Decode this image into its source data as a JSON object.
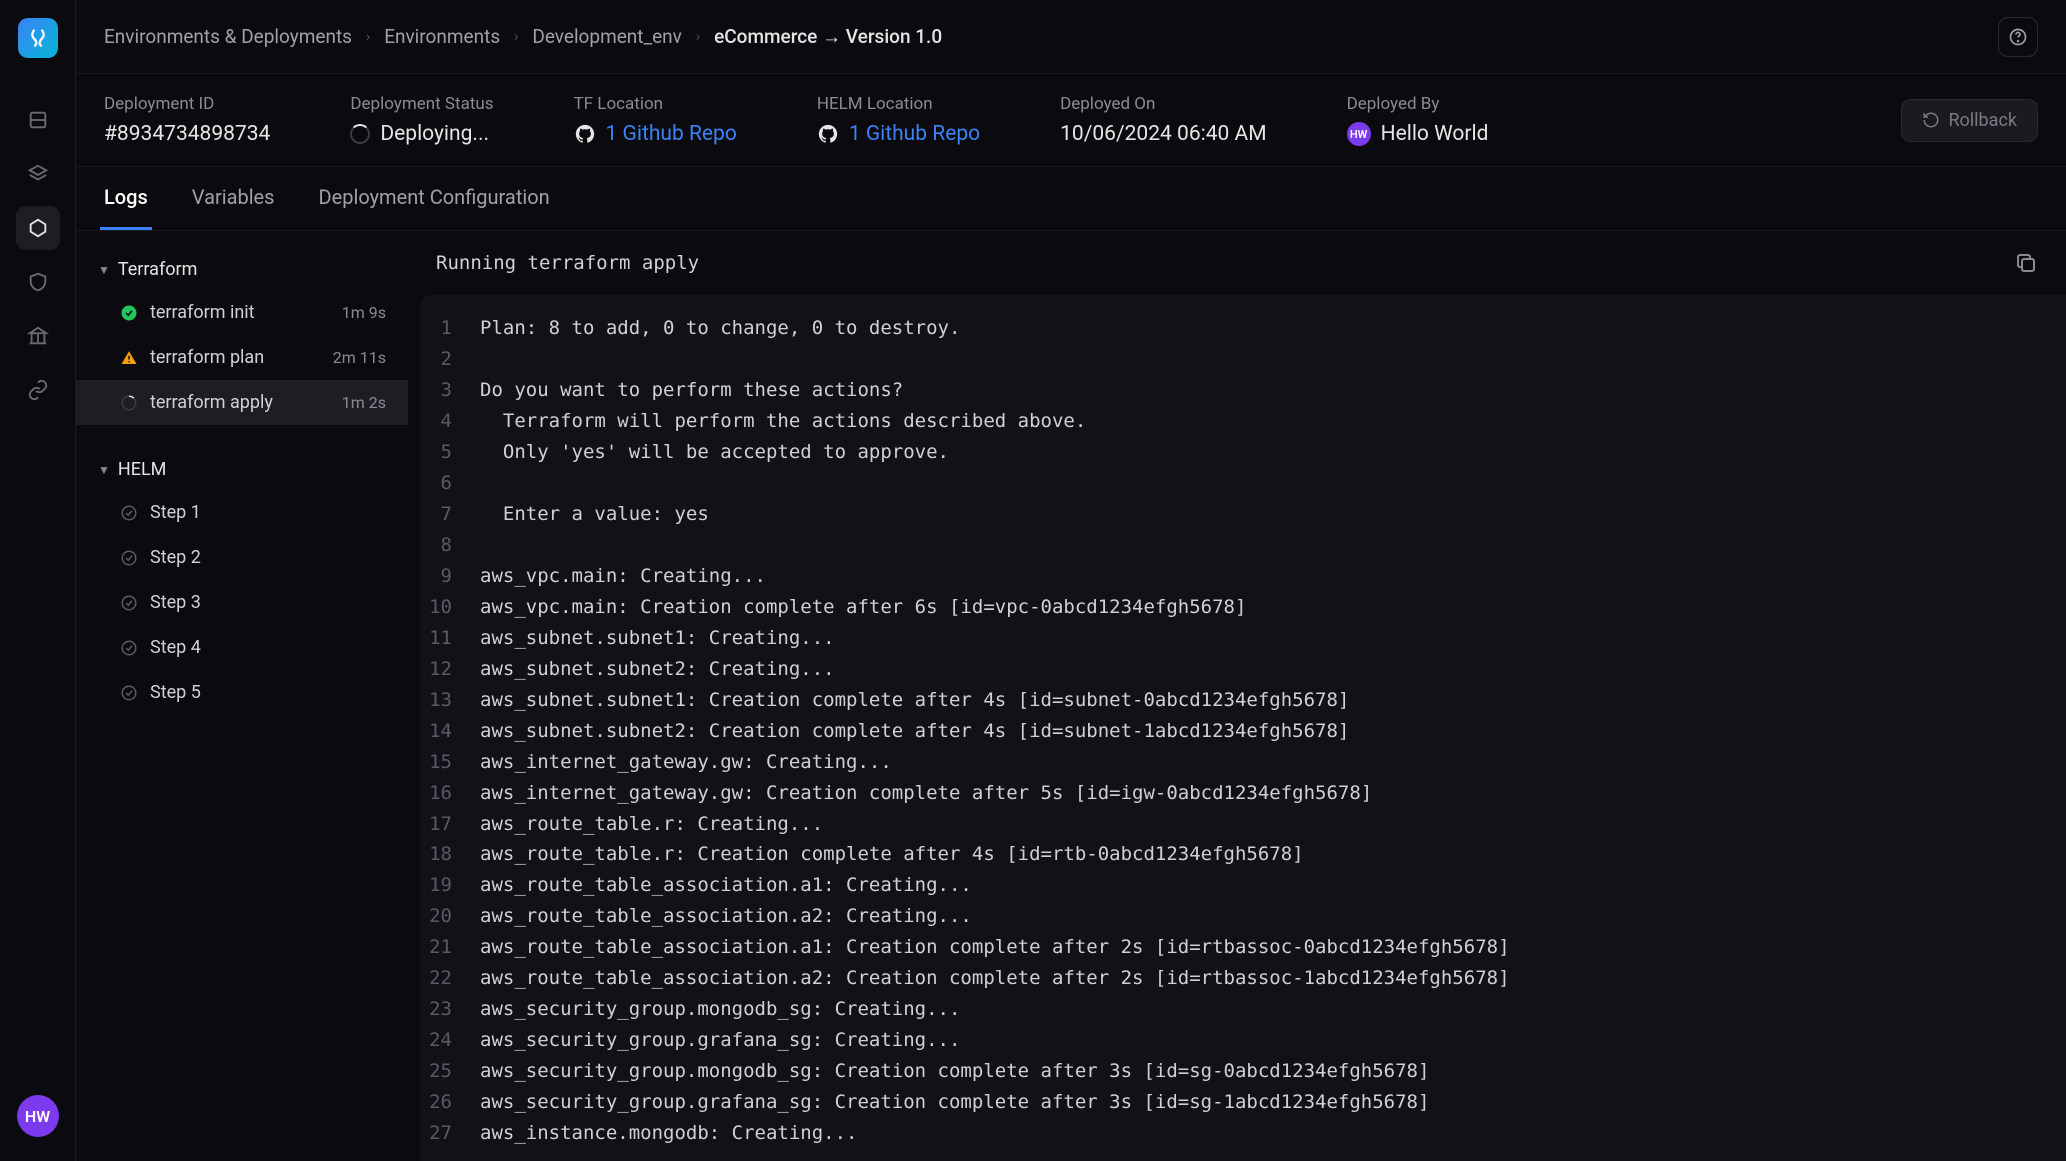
{
  "breadcrumb": [
    {
      "label": "Environments & Deployments"
    },
    {
      "label": "Environments"
    },
    {
      "label": "Development_env"
    },
    {
      "label": "eCommerce → Version 1.0"
    }
  ],
  "info": {
    "deployment_id": {
      "label": "Deployment ID",
      "value": "#8934734898734"
    },
    "deployment_status": {
      "label": "Deployment Status",
      "value": "Deploying..."
    },
    "tf_location": {
      "label": "TF Location",
      "value": "1 Github Repo"
    },
    "helm_location": {
      "label": "HELM Location",
      "value": "1 Github Repo"
    },
    "deployed_on": {
      "label": "Deployed On",
      "value": "10/06/2024 06:40 AM"
    },
    "deployed_by": {
      "label": "Deployed By",
      "value": "Hello World",
      "initials": "HW"
    }
  },
  "rollback_label": "Rollback",
  "tabs": [
    {
      "label": "Logs",
      "active": true
    },
    {
      "label": "Variables"
    },
    {
      "label": "Deployment Configuration"
    }
  ],
  "step_groups": [
    {
      "name": "Terraform",
      "steps": [
        {
          "label": "terraform init",
          "time": "1m 9s",
          "status": "success"
        },
        {
          "label": "terraform plan",
          "time": "2m 11s",
          "status": "warning"
        },
        {
          "label": "terraform apply",
          "time": "1m 2s",
          "status": "running",
          "active": true
        }
      ]
    },
    {
      "name": "HELM",
      "steps": [
        {
          "label": "Step 1",
          "status": "pending"
        },
        {
          "label": "Step 2",
          "status": "pending"
        },
        {
          "label": "Step 3",
          "status": "pending"
        },
        {
          "label": "Step 4",
          "status": "pending"
        },
        {
          "label": "Step 5",
          "status": "pending"
        }
      ]
    }
  ],
  "log_header": "Running terraform apply",
  "log_lines": [
    "Plan: 8 to add, 0 to change, 0 to destroy.",
    "",
    "Do you want to perform these actions?",
    "  Terraform will perform the actions described above.",
    "  Only 'yes' will be accepted to approve.",
    "",
    "  Enter a value: yes",
    "",
    "aws_vpc.main: Creating...",
    "aws_vpc.main: Creation complete after 6s [id=vpc-0abcd1234efgh5678]",
    "aws_subnet.subnet1: Creating...",
    "aws_subnet.subnet2: Creating...",
    "aws_subnet.subnet1: Creation complete after 4s [id=subnet-0abcd1234efgh5678]",
    "aws_subnet.subnet2: Creation complete after 4s [id=subnet-1abcd1234efgh5678]",
    "aws_internet_gateway.gw: Creating...",
    "aws_internet_gateway.gw: Creation complete after 5s [id=igw-0abcd1234efgh5678]",
    "aws_route_table.r: Creating...",
    "aws_route_table.r: Creation complete after 4s [id=rtb-0abcd1234efgh5678]",
    "aws_route_table_association.a1: Creating...",
    "aws_route_table_association.a2: Creating...",
    "aws_route_table_association.a1: Creation complete after 2s [id=rtbassoc-0abcd1234efgh5678]",
    "aws_route_table_association.a2: Creation complete after 2s [id=rtbassoc-1abcd1234efgh5678]",
    "aws_security_group.mongodb_sg: Creating...",
    "aws_security_group.grafana_sg: Creating...",
    "aws_security_group.mongodb_sg: Creation complete after 3s [id=sg-0abcd1234efgh5678]",
    "aws_security_group.grafana_sg: Creation complete after 3s [id=sg-1abcd1234efgh5678]",
    "aws_instance.mongodb: Creating..."
  ],
  "avatar_initials": "HW"
}
